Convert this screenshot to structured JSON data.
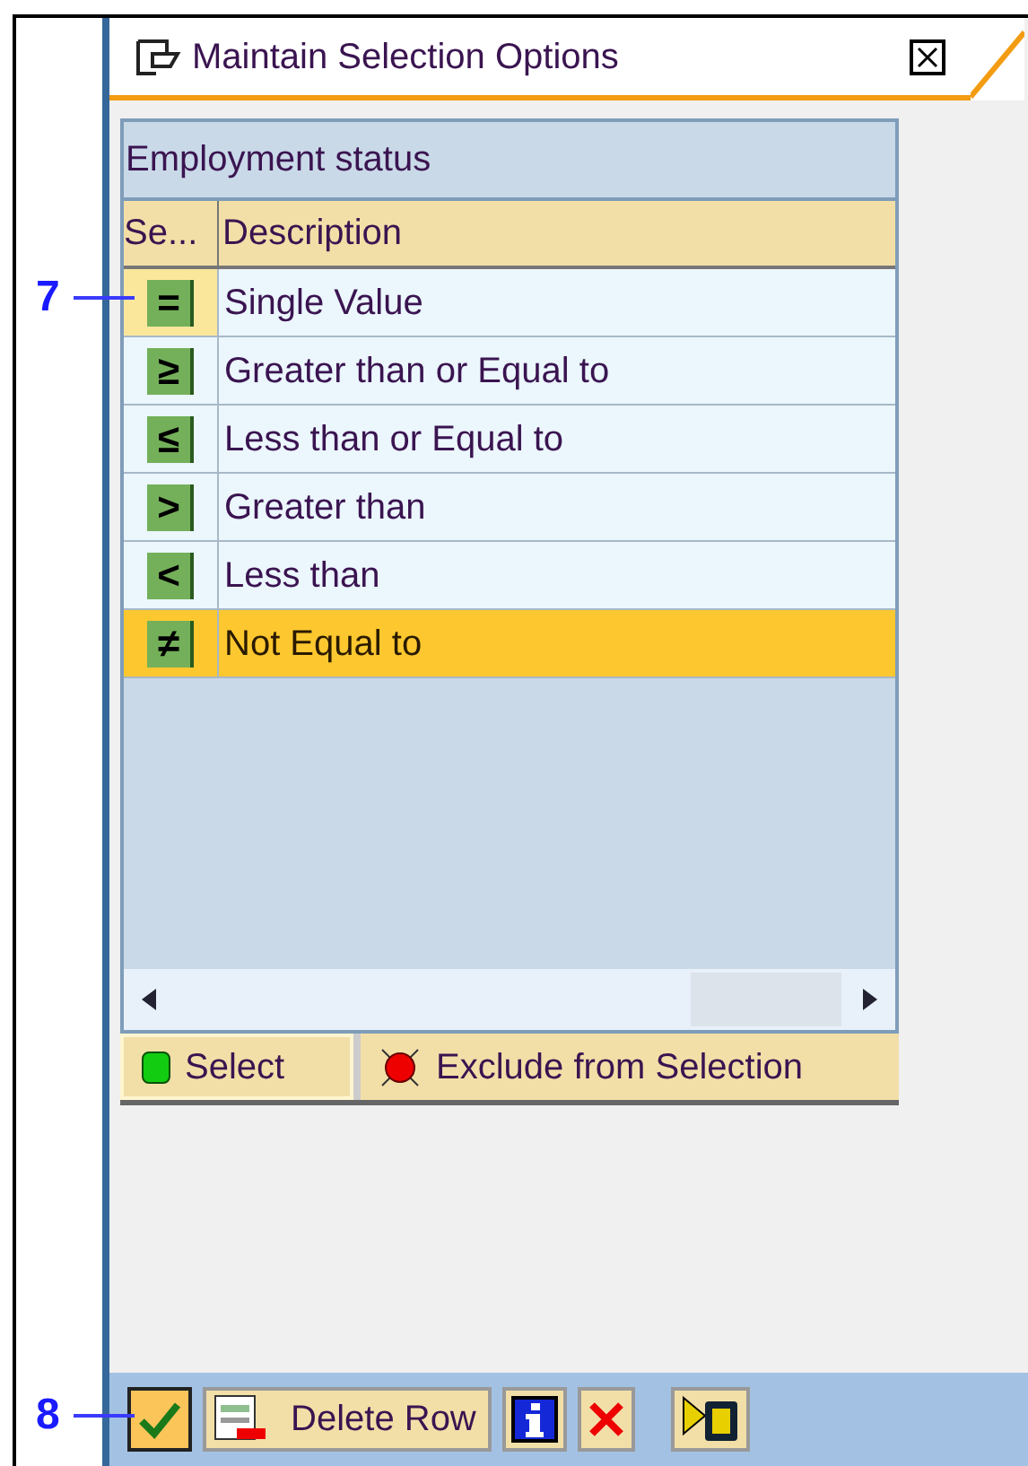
{
  "dialog": {
    "title": "Maintain Selection Options"
  },
  "table": {
    "title": "Employment status",
    "columns": [
      "Se...",
      "Description"
    ],
    "rows": [
      {
        "symbol": "=",
        "description": "Single Value",
        "selected": false,
        "current": true,
        "callout": "7"
      },
      {
        "symbol": "≥",
        "description": "Greater than or Equal to",
        "selected": false,
        "current": false
      },
      {
        "symbol": "≤",
        "description": "Less than or Equal to",
        "selected": false,
        "current": false
      },
      {
        "symbol": ">",
        "description": "Greater than",
        "selected": false,
        "current": false
      },
      {
        "symbol": "<",
        "description": "Less than",
        "selected": false,
        "current": false
      },
      {
        "symbol": "≠",
        "description": "Not Equal to",
        "selected": true,
        "current": false
      }
    ]
  },
  "tabs": [
    {
      "label": "Select",
      "kind": "include",
      "selected": true
    },
    {
      "label": "Exclude from Selection",
      "kind": "exclude",
      "selected": false
    }
  ],
  "toolbar": [
    {
      "kind": "confirm",
      "active": true,
      "callout": "8"
    },
    {
      "kind": "delete",
      "label": "Delete Row",
      "active": false
    },
    {
      "kind": "info",
      "active": false
    },
    {
      "kind": "cancel",
      "active": false
    },
    {
      "kind": "more",
      "active": false
    }
  ]
}
